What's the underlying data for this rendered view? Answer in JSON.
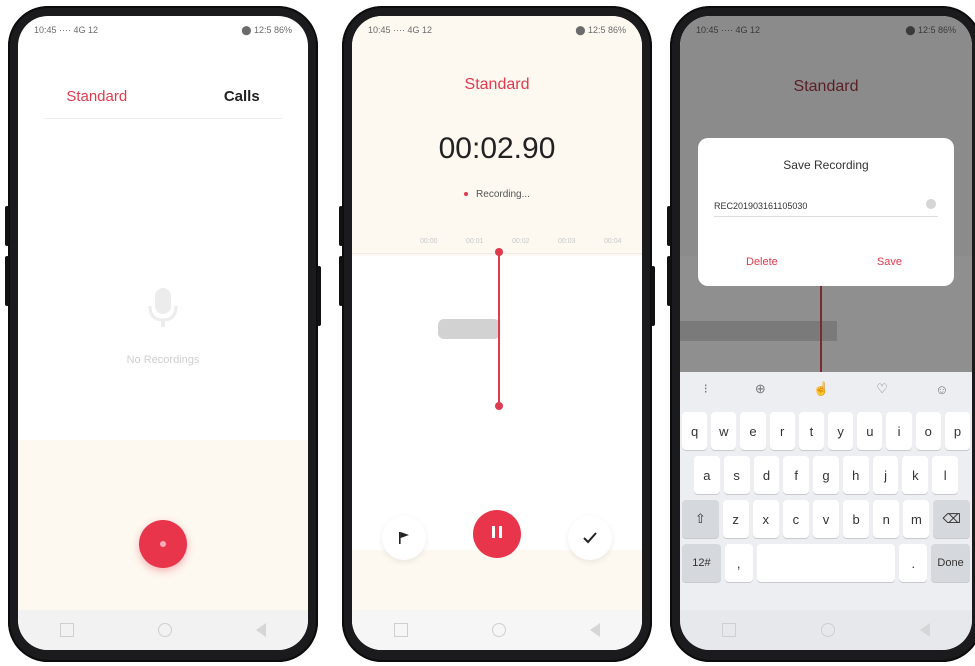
{
  "colors": {
    "accent": "#e03a4f",
    "record_button": "#e9354b"
  },
  "phone1": {
    "status": {
      "left": "10:45 ···· 4G 12",
      "right": "⬤ 12:5 86%"
    },
    "tabs": [
      {
        "label": "Standard",
        "active": true
      },
      {
        "label": "Calls",
        "active": false
      }
    ],
    "empty_state": {
      "icon": "microphone-icon",
      "text": "No Recordings"
    },
    "record_button_icon": "record-icon"
  },
  "phone2": {
    "status": {
      "left": "10:45 ···· 4G 12",
      "right": "⬤ 12:5 86%"
    },
    "title": "Standard",
    "timer": "00:02.90",
    "recording_status": "Recording...",
    "timeline_ticks": [
      "00:00",
      "00:01",
      "00:02",
      "00:03",
      "00:04"
    ],
    "controls": {
      "flag_icon": "flag-icon",
      "pause_icon": "pause-icon",
      "done_icon": "check-icon"
    }
  },
  "phone3": {
    "status": {
      "left": "10:45 ···· 4G 12",
      "right": "⬤ 12:5 86%"
    },
    "title": "Standard",
    "dialog": {
      "title": "Save Recording",
      "filename": "REC201903161105030",
      "delete_label": "Delete",
      "save_label": "Save"
    },
    "keyboard": {
      "toolbar": [
        "⁝",
        "⊕",
        "☝",
        "♡",
        "☺"
      ],
      "row1": [
        "q",
        "w",
        "e",
        "r",
        "t",
        "y",
        "u",
        "i",
        "o",
        "p"
      ],
      "row2": [
        "a",
        "s",
        "d",
        "f",
        "g",
        "h",
        "j",
        "k",
        "l"
      ],
      "row3": [
        "⇧",
        "z",
        "x",
        "c",
        "v",
        "b",
        "n",
        "m",
        "⌫"
      ],
      "row4": [
        "12#",
        ",",
        "",
        ".",
        "Done"
      ]
    }
  }
}
